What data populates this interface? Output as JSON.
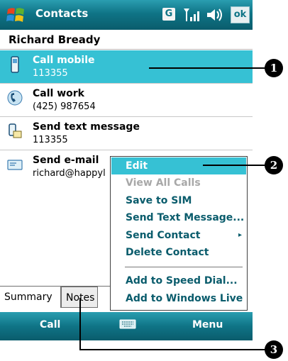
{
  "titlebar": {
    "title": "Contacts",
    "g_label": "G",
    "ok_label": "ok",
    "icons": [
      "windows-start-icon",
      "signal-icon",
      "volume-icon"
    ]
  },
  "contact": {
    "name": "Richard Bready"
  },
  "actions": [
    {
      "label": "Call mobile",
      "detail": "113355",
      "icon": "mobile-phone-icon",
      "selected": true
    },
    {
      "label": "Call work",
      "detail": "(425) 987654",
      "icon": "work-phone-icon",
      "selected": false
    },
    {
      "label": "Send text message",
      "detail": "113355",
      "icon": "sms-icon",
      "selected": false
    },
    {
      "label": "Send e-mail",
      "detail": "richard@happyl",
      "icon": "email-icon",
      "selected": false
    }
  ],
  "menu": {
    "items": [
      {
        "label": "Edit",
        "highlighted": true,
        "disabled": false
      },
      {
        "label": "View All Calls",
        "highlighted": false,
        "disabled": true
      },
      {
        "label": "Save to SIM",
        "highlighted": false,
        "disabled": false
      },
      {
        "label": "Send Text Message...",
        "highlighted": false,
        "disabled": false
      },
      {
        "label": "Send Contact",
        "highlighted": false,
        "disabled": false,
        "submenu": true
      },
      {
        "label": "Delete Contact",
        "highlighted": false,
        "disabled": false
      },
      {
        "label": "Add to Speed Dial...",
        "highlighted": false,
        "disabled": false
      },
      {
        "label": "Add to Windows Live",
        "highlighted": false,
        "disabled": false
      }
    ],
    "submenu_arrow": "▸"
  },
  "tabs": [
    {
      "label": "Summary",
      "active": true
    },
    {
      "label": "Notes",
      "active": false
    }
  ],
  "softkeys": {
    "left": "Call",
    "right": "Menu",
    "center_icon": "keyboard-icon"
  },
  "callouts": [
    "1",
    "2",
    "3"
  ],
  "colors": {
    "titlebar": "#0f7486",
    "highlight": "#36c1d4",
    "menu_text": "#0a5c6c",
    "disabled_text": "#a8a8a8"
  }
}
